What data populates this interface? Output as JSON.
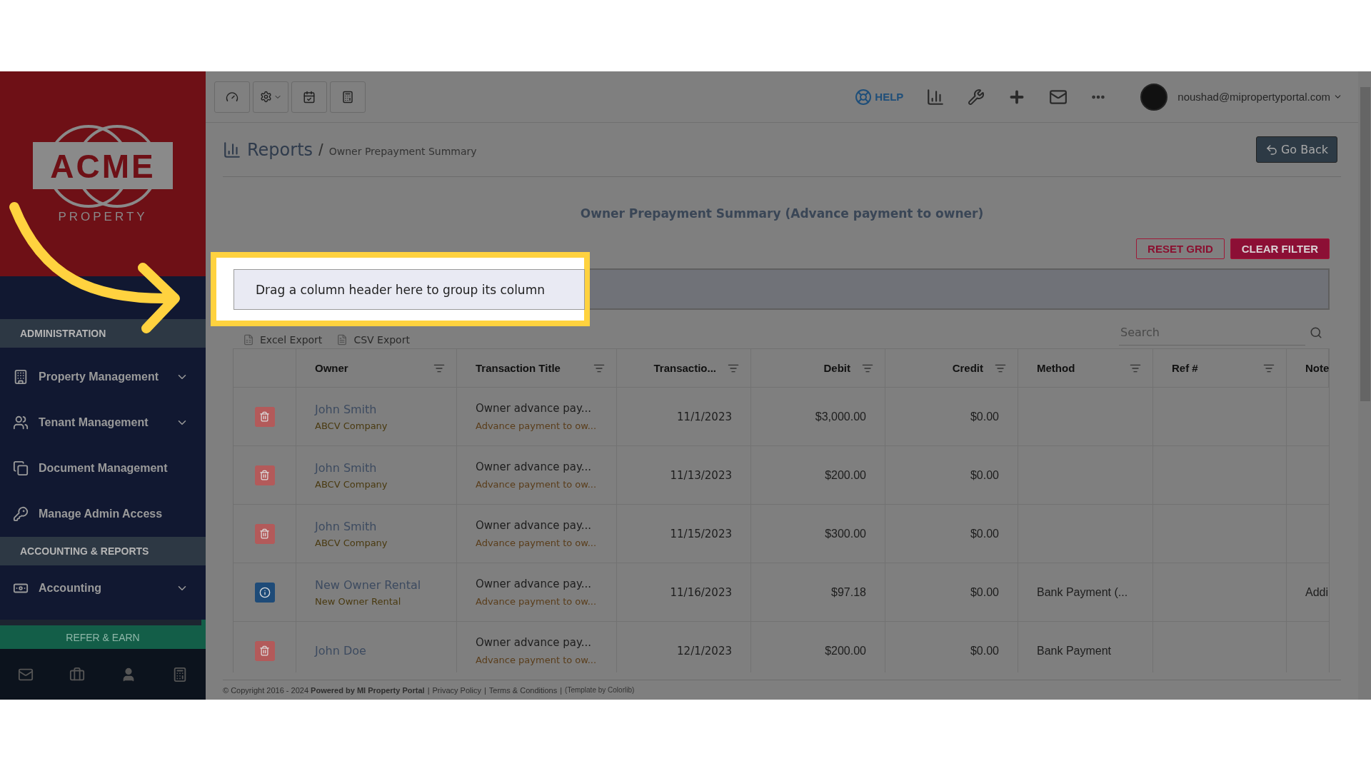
{
  "sidebar": {
    "logo": {
      "wordmark": "ACME",
      "tagline": "PROPERTY"
    },
    "sections": [
      {
        "title": "ADMINISTRATION",
        "items": [
          {
            "label": "Property Management",
            "expandable": true
          },
          {
            "label": "Tenant Management",
            "expandable": true
          },
          {
            "label": "Document Management",
            "expandable": false
          },
          {
            "label": "Manage Admin Access",
            "expandable": false
          }
        ]
      },
      {
        "title": "ACCOUNTING & REPORTS",
        "items": [
          {
            "label": "Accounting",
            "expandable": true
          }
        ]
      }
    ],
    "refer_button": "REFER & EARN"
  },
  "toolbar": {
    "help": "HELP",
    "user_email": "noushad@mipropertyportal.com"
  },
  "breadcrumb": {
    "section": "Reports",
    "separator": "/",
    "page": "Owner Prepayment Summary"
  },
  "go_back": "Go Back",
  "report_title": "Owner Prepayment Summary (Advance payment to owner)",
  "grid_buttons": [
    {
      "label": "RESET GRID",
      "kind": "outline"
    },
    {
      "label": "CLEAR FILTER",
      "kind": "filled"
    }
  ],
  "group_panel": "Drag a column header here to group its column",
  "exports": [
    "Excel Export",
    "CSV Export"
  ],
  "search": {
    "placeholder": "Search"
  },
  "table": {
    "columns": [
      {
        "label": "Owner",
        "kind": "text"
      },
      {
        "label": "Transaction Title",
        "kind": "text"
      },
      {
        "label": "Transactio...",
        "kind": "number"
      },
      {
        "label": "Debit",
        "kind": "number"
      },
      {
        "label": "Credit",
        "kind": "number"
      },
      {
        "label": "Method",
        "kind": "text"
      },
      {
        "label": "Ref #",
        "kind": "text"
      },
      {
        "label": "Note",
        "kind": "text"
      }
    ],
    "rows": [
      {
        "kind": "delete",
        "owner": "John Smith",
        "company": "ABCV Company",
        "title": "Owner advance pay...",
        "subtitle": "Advance payment to ow...",
        "date": "11/1/2023",
        "debit": "$3,000.00",
        "credit": "$0.00"
      },
      {
        "kind": "delete",
        "owner": "John Smith",
        "company": "ABCV Company",
        "title": "Owner advance pay...",
        "subtitle": "Advance payment to ow...",
        "date": "11/13/2023",
        "debit": "$200.00",
        "credit": "$0.00"
      },
      {
        "kind": "delete",
        "owner": "John Smith",
        "company": "ABCV Company",
        "title": "Owner advance pay...",
        "subtitle": "Advance payment to ow...",
        "date": "11/15/2023",
        "debit": "$300.00",
        "credit": "$0.00"
      },
      {
        "kind": "info",
        "owner": "New Owner Rental",
        "company": "New Owner Rental",
        "title": "Owner advance pay...",
        "subtitle": "Advance payment to ow...",
        "date": "11/16/2023",
        "debit": "$97.18",
        "credit": "$0.00",
        "method": "Bank Payment (...",
        "note": "Addi"
      },
      {
        "kind": "delete",
        "owner": "John Doe",
        "title": "Owner advance pay...",
        "subtitle": "Advance payment to ow...",
        "date": "12/1/2023",
        "debit": "$200.00",
        "credit": "$0.00",
        "method": "Bank Payment"
      }
    ]
  },
  "footer": [
    {
      "kind": "text",
      "text": "© Copyright 2016 - 2024 **Powered by MI Property Portal**"
    },
    {
      "kind": "separator",
      "text": "|"
    },
    {
      "kind": "link",
      "text": "Privacy Policy"
    },
    {
      "kind": "separator",
      "text": "|"
    },
    {
      "kind": "link",
      "text": "Terms & Conditions"
    },
    {
      "kind": "separator",
      "text": "|"
    },
    {
      "kind": "credit",
      "text": "(Template by Colorlib)"
    }
  ]
}
